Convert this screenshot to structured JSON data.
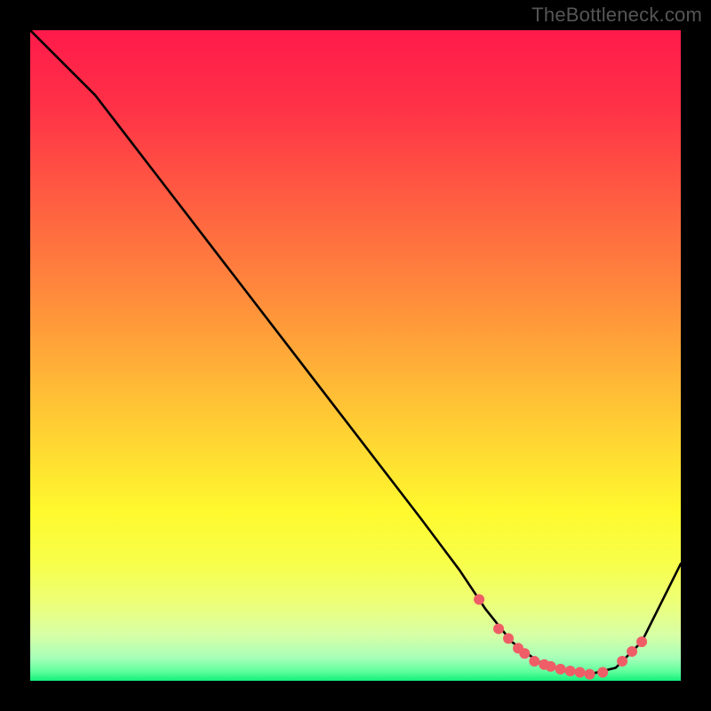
{
  "watermark": "TheBottleneck.com",
  "chart_data": {
    "type": "line",
    "title": "",
    "xlabel": "",
    "ylabel": "",
    "xlim": [
      0,
      100
    ],
    "ylim": [
      0,
      100
    ],
    "grid": false,
    "series": [
      {
        "name": "curve",
        "color": "#000000",
        "x": [
          0,
          6,
          10,
          20,
          30,
          40,
          50,
          60,
          66,
          70,
          74,
          78,
          82,
          86,
          90,
          94,
          100
        ],
        "y": [
          100,
          94,
          90,
          77,
          64,
          51,
          38,
          25,
          17,
          11,
          6,
          3,
          1.5,
          1,
          2,
          6,
          18
        ]
      }
    ],
    "markers": {
      "name": "bottleneck-points",
      "color": "#ef5e67",
      "radius": 6,
      "x": [
        69,
        72,
        73.5,
        75,
        76,
        77.5,
        79,
        80,
        81.5,
        83,
        84.5,
        86,
        88,
        91,
        92.5,
        94
      ],
      "y": [
        12.5,
        8,
        6.5,
        5,
        4.2,
        3,
        2.5,
        2.2,
        1.8,
        1.5,
        1.3,
        1,
        1.3,
        3,
        4.5,
        6
      ]
    },
    "gradient_stops": [
      {
        "offset": 0.0,
        "color": "#ff1a4b"
      },
      {
        "offset": 0.12,
        "color": "#ff3247"
      },
      {
        "offset": 0.25,
        "color": "#ff5a42"
      },
      {
        "offset": 0.38,
        "color": "#ff823d"
      },
      {
        "offset": 0.5,
        "color": "#ffaa38"
      },
      {
        "offset": 0.62,
        "color": "#ffd233"
      },
      {
        "offset": 0.74,
        "color": "#fff92e"
      },
      {
        "offset": 0.82,
        "color": "#f7ff4a"
      },
      {
        "offset": 0.88,
        "color": "#edff78"
      },
      {
        "offset": 0.93,
        "color": "#d7ffa6"
      },
      {
        "offset": 0.965,
        "color": "#a6ffb8"
      },
      {
        "offset": 0.985,
        "color": "#62ff9e"
      },
      {
        "offset": 1.0,
        "color": "#14f07a"
      }
    ]
  }
}
